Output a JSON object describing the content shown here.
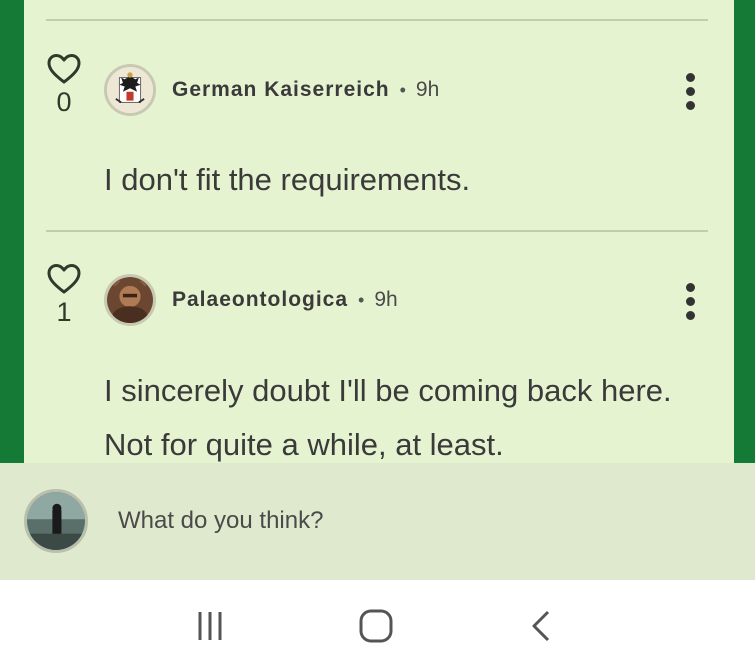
{
  "comments": [
    {
      "likes": "0",
      "author": "German Kaiserreich",
      "separator": "•",
      "time": "9h",
      "text": "I don't fit the requirements."
    },
    {
      "likes": "1",
      "author": "Palaeontologica",
      "separator": "•",
      "time": "9h",
      "text": "I sincerely doubt I'll be coming back here. Not for quite a while, at least."
    }
  ],
  "composer": {
    "placeholder": "What do you think?"
  },
  "icons": {
    "like": "heart-icon",
    "more": "more-vertical-icon",
    "nav_recents": "recents-icon",
    "nav_home": "home-icon",
    "nav_back": "back-icon"
  },
  "colors": {
    "frame_green": "#147a36",
    "card_bg": "#e6f3d0",
    "composer_bg": "#dfe9cd"
  }
}
